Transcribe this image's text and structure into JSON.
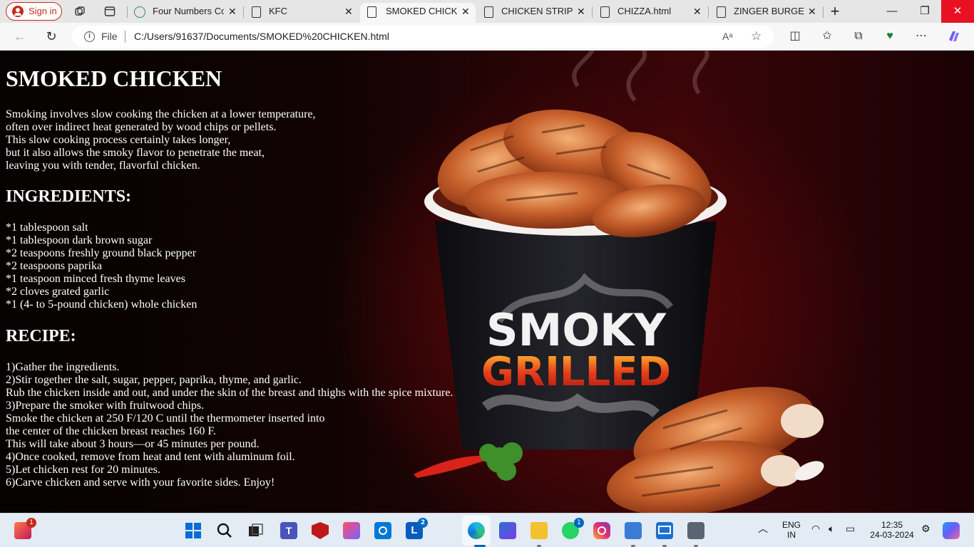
{
  "browser": {
    "signin_label": "Sign in",
    "tabs": [
      {
        "label": "Four Numbers Cor",
        "icon": "chatgpt-icon"
      },
      {
        "label": "KFC",
        "icon": "document-icon"
      },
      {
        "label": "SMOKED CHICKEN",
        "icon": "document-icon"
      },
      {
        "label": "CHICKEN STRIPS",
        "icon": "document-icon"
      },
      {
        "label": "CHIZZA.html",
        "icon": "document-icon"
      },
      {
        "label": "ZINGER BURGER",
        "icon": "document-icon"
      }
    ],
    "file_label": "File",
    "url": "C:/Users/91637/Documents/SMOKED%20CHICKEN.html"
  },
  "page": {
    "title": "SMOKED CHICKEN",
    "intro": [
      "Smoking involves slow cooking the chicken at a lower temperature,",
      "often over indirect heat generated by wood chips or pellets.",
      "This slow cooking process certainly takes longer,",
      "but it also allows the smoky flavor to penetrate the meat,",
      "leaving you with tender, flavorful chicken."
    ],
    "ingredients_title": "INGREDIENTS:",
    "ingredients": [
      "*1 tablespoon salt",
      "*1 tablespoon dark brown sugar",
      "*2 teaspoons freshly ground black pepper",
      "*2 teaspoons paprika",
      "*1 teaspoon minced fresh thyme leaves",
      "*2 cloves grated garlic",
      "*1 (4- to 5-pound chicken) whole chicken"
    ],
    "recipe_title": "RECIPE:",
    "recipe": [
      "1)Gather the ingredients.",
      "2)Stir together the salt, sugar, pepper, paprika, thyme, and garlic.",
      "Rub the chicken inside and out, and under the skin of the breast and thighs with the spice mixture.",
      "3)Prepare the smoker with fruitwood chips.",
      "Smoke the chicken at 250 F/120 C until the thermometer inserted into",
      "the center of the chicken breast reaches 160 F.",
      "This will take about 3 hours—or 45 minutes per pound.",
      "4)Once cooked, remove from heat and tent with aluminum foil.",
      "5)Let chicken rest for 20 minutes.",
      "6)Carve chicken and serve with your favorite sides. Enjoy!"
    ],
    "image_text": {
      "line1": "SMOKY",
      "line2": "GRILLED"
    }
  },
  "taskbar": {
    "badges": {
      "copilot_app": "1",
      "lens": "2",
      "whatsapp": "1"
    },
    "language": "ENG",
    "region": "IN",
    "time": "12:35",
    "date": "24-03-2024"
  },
  "colors": {
    "accent_red": "#c42b1c",
    "close_red": "#e81123",
    "page_dark": "#1a0204"
  }
}
